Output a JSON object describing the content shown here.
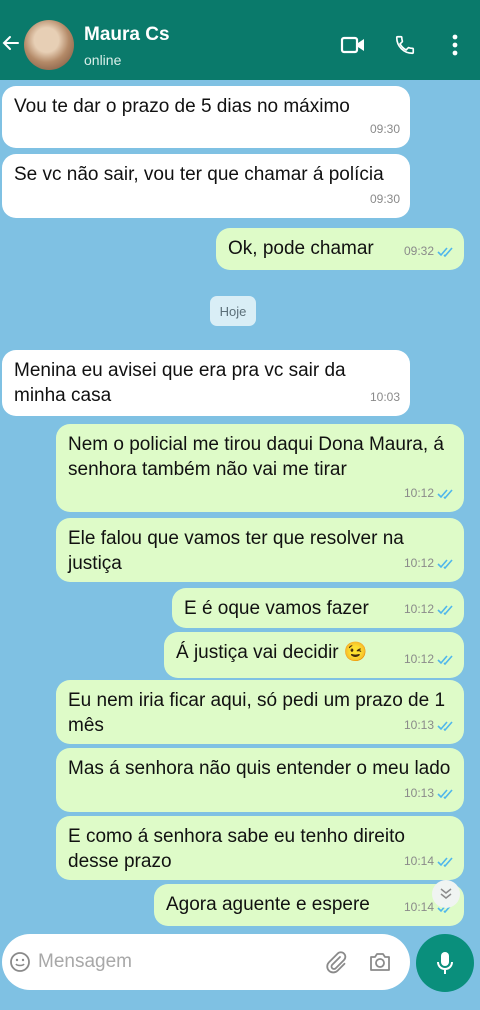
{
  "header": {
    "contact_name": "Maura Cs",
    "status": "online"
  },
  "date_chip": "Hoje",
  "messages": [
    {
      "text": "Vou te dar o prazo de 5 dias no máximo",
      "time": "09:30",
      "direction": "in"
    },
    {
      "text": "Se vc não sair, vou ter que chamar á polícia",
      "time": "09:30",
      "direction": "in"
    },
    {
      "text": "Ok, pode chamar",
      "time": "09:32",
      "direction": "out",
      "read": true
    },
    {
      "text": "Menina eu avisei que era pra vc sair da minha casa",
      "time": "10:03",
      "direction": "in"
    },
    {
      "text": "Nem o policial me tirou daqui Dona Maura, á senhora também não vai me tirar",
      "time": "10:12",
      "direction": "out",
      "read": true
    },
    {
      "text": "Ele falou que vamos ter que resolver na justiça",
      "time": "10:12",
      "direction": "out",
      "read": true
    },
    {
      "text": "E é oque vamos fazer",
      "time": "10:12",
      "direction": "out",
      "read": true
    },
    {
      "text": "Á justiça vai decidir 😉",
      "time": "10:12",
      "direction": "out",
      "read": true
    },
    {
      "text": "Eu nem iria ficar aqui, só pedi um prazo de 1 mês",
      "time": "10:13",
      "direction": "out",
      "read": true
    },
    {
      "text": "Mas á senhora não quis entender o meu lado",
      "time": "10:13",
      "direction": "out",
      "read": true
    },
    {
      "text": "E como á senhora sabe eu tenho direito desse prazo",
      "time": "10:14",
      "direction": "out",
      "read": true
    },
    {
      "text": "Agora aguente e espere",
      "time": "10:14",
      "direction": "out",
      "read": true
    }
  ],
  "composer": {
    "placeholder": "Mensagem"
  },
  "icons": {
    "back": "arrow-left-icon",
    "video": "video-camera-icon",
    "call": "phone-icon",
    "menu": "more-vertical-icon",
    "emoji": "emoji-icon",
    "attach": "paperclip-icon",
    "camera": "camera-icon",
    "mic": "microphone-icon",
    "scroll": "double-chevron-down-icon"
  },
  "colors": {
    "header": "#0a7a6b",
    "chat_background": "#7fc1e3",
    "outgoing_bubble": "#defbc8",
    "incoming_bubble": "#ffffff",
    "read_ticks": "#4fb6ec",
    "mic_button": "#0a8f7c"
  }
}
